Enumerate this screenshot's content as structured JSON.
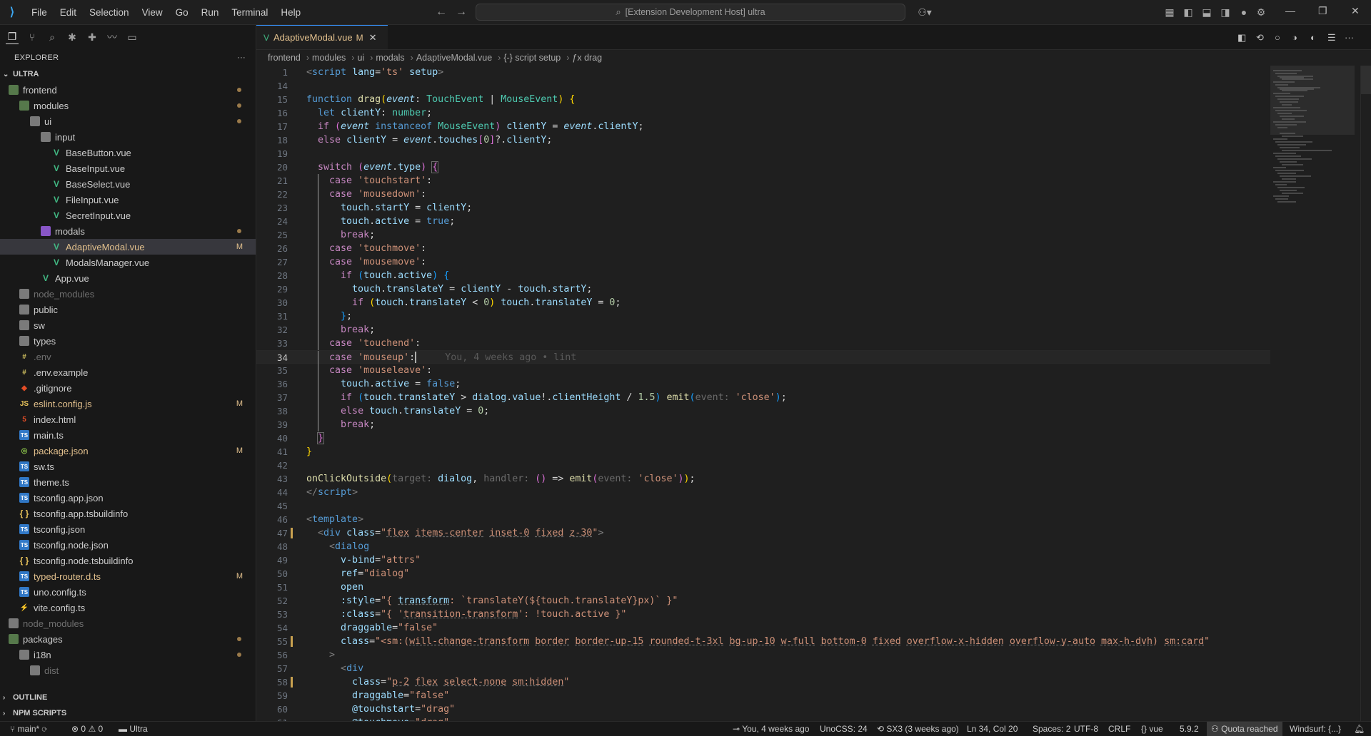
{
  "titlebar": {
    "menu": [
      "File",
      "Edit",
      "Selection",
      "View",
      "Go",
      "Run",
      "Terminal",
      "Help"
    ],
    "command_center": "[Extension Development Host] ultra"
  },
  "sidebar": {
    "explorer_title": "EXPLORER",
    "more": "···",
    "workspace": "ULTRA",
    "tree": [
      {
        "label": "frontend",
        "indent": 0,
        "type": "folder-src",
        "status": "dot"
      },
      {
        "label": "modules",
        "indent": 1,
        "type": "folder-src",
        "status": "dot"
      },
      {
        "label": "ui",
        "indent": 2,
        "type": "folder",
        "status": "dot"
      },
      {
        "label": "input",
        "indent": 3,
        "type": "folder",
        "status": ""
      },
      {
        "label": "BaseButton.vue",
        "indent": 4,
        "type": "vue",
        "status": ""
      },
      {
        "label": "BaseInput.vue",
        "indent": 4,
        "type": "vue",
        "status": ""
      },
      {
        "label": "BaseSelect.vue",
        "indent": 4,
        "type": "vue",
        "status": ""
      },
      {
        "label": "FileInput.vue",
        "indent": 4,
        "type": "vue",
        "status": ""
      },
      {
        "label": "SecretInput.vue",
        "indent": 4,
        "type": "vue",
        "status": ""
      },
      {
        "label": "modals",
        "indent": 3,
        "type": "folder-mods",
        "status": "dot"
      },
      {
        "label": "AdaptiveModal.vue",
        "indent": 4,
        "type": "vue",
        "status": "M",
        "selected": true
      },
      {
        "label": "ModalsManager.vue",
        "indent": 4,
        "type": "vue",
        "status": ""
      },
      {
        "label": "App.vue",
        "indent": 3,
        "type": "vue",
        "status": ""
      },
      {
        "label": "node_modules",
        "indent": 1,
        "type": "folder",
        "status": "",
        "ignored": true
      },
      {
        "label": "public",
        "indent": 1,
        "type": "folder",
        "status": ""
      },
      {
        "label": "sw",
        "indent": 1,
        "type": "folder",
        "status": ""
      },
      {
        "label": "types",
        "indent": 1,
        "type": "folder",
        "status": ""
      },
      {
        "label": ".env",
        "indent": 1,
        "type": "env",
        "status": "",
        "ignored": true
      },
      {
        "label": ".env.example",
        "indent": 1,
        "type": "env",
        "status": ""
      },
      {
        "label": ".gitignore",
        "indent": 1,
        "type": "git",
        "status": ""
      },
      {
        "label": "eslint.config.js",
        "indent": 1,
        "type": "js",
        "status": "M"
      },
      {
        "label": "index.html",
        "indent": 1,
        "type": "html",
        "status": ""
      },
      {
        "label": "main.ts",
        "indent": 1,
        "type": "ts",
        "status": ""
      },
      {
        "label": "package.json",
        "indent": 1,
        "type": "npm",
        "status": "M"
      },
      {
        "label": "sw.ts",
        "indent": 1,
        "type": "ts",
        "status": ""
      },
      {
        "label": "theme.ts",
        "indent": 1,
        "type": "ts",
        "status": ""
      },
      {
        "label": "tsconfig.app.json",
        "indent": 1,
        "type": "ts",
        "status": ""
      },
      {
        "label": "tsconfig.app.tsbuildinfo",
        "indent": 1,
        "type": "json",
        "status": ""
      },
      {
        "label": "tsconfig.json",
        "indent": 1,
        "type": "ts",
        "status": ""
      },
      {
        "label": "tsconfig.node.json",
        "indent": 1,
        "type": "ts",
        "status": ""
      },
      {
        "label": "tsconfig.node.tsbuildinfo",
        "indent": 1,
        "type": "json",
        "status": ""
      },
      {
        "label": "typed-router.d.ts",
        "indent": 1,
        "type": "ts",
        "status": "M"
      },
      {
        "label": "uno.config.ts",
        "indent": 1,
        "type": "ts",
        "status": ""
      },
      {
        "label": "vite.config.ts",
        "indent": 1,
        "type": "vite",
        "status": ""
      },
      {
        "label": "node_modules",
        "indent": 0,
        "type": "folder",
        "status": "",
        "ignored": true
      },
      {
        "label": "packages",
        "indent": 0,
        "type": "folder-src",
        "status": "dot"
      },
      {
        "label": "i18n",
        "indent": 1,
        "type": "folder",
        "status": "dot"
      },
      {
        "label": "dist",
        "indent": 2,
        "type": "folder",
        "status": "",
        "ignored": true
      }
    ],
    "outline": "OUTLINE",
    "npm_scripts": "NPM SCRIPTS"
  },
  "editor": {
    "tab": {
      "name": "AdaptiveModal.vue",
      "modified": "M",
      "close": "✕"
    },
    "breadcrumb": [
      "frontend",
      "modules",
      "ui",
      "modals",
      "AdaptiveModal.vue",
      "{-} script setup",
      "ƒx drag"
    ],
    "header_line": "<script lang='ts' setup>",
    "current_line": 34,
    "blame": "You, 4 weeks ago • lint",
    "line_numbers": [
      "14",
      "15",
      "16",
      "17",
      "18",
      "19",
      "20",
      "21",
      "22",
      "23",
      "24",
      "25",
      "26",
      "27",
      "28",
      "29",
      "30",
      "31",
      "32",
      "33",
      "34",
      "35",
      "36",
      "37",
      "38",
      "39",
      "40",
      "41",
      "42",
      "43",
      "44",
      "45",
      "46",
      "47",
      "48",
      "49",
      "50",
      "51",
      "52",
      "53",
      "54",
      "55",
      "56",
      "57",
      "58",
      "59",
      "60",
      "61"
    ]
  },
  "statusbar": {
    "branch": "main*",
    "sync": "⟳",
    "errors": "0",
    "warnings": "0",
    "folder": "Ultra",
    "blame": "You, 4 weeks ago",
    "unocss": "UnoCSS: 24",
    "sx3": "SX3 (3 weeks ago)",
    "position": "Ln 34, Col 20",
    "spaces": "Spaces: 2",
    "encoding": "UTF-8",
    "eol": "CRLF",
    "language": "vue",
    "version": "5.9.2",
    "quota": "Quota reached",
    "windsurf": "Windsurf: {...}"
  },
  "colors": {
    "accent": "#3794ff",
    "modified": "#e2c08d",
    "background": "#1f1f1f"
  }
}
